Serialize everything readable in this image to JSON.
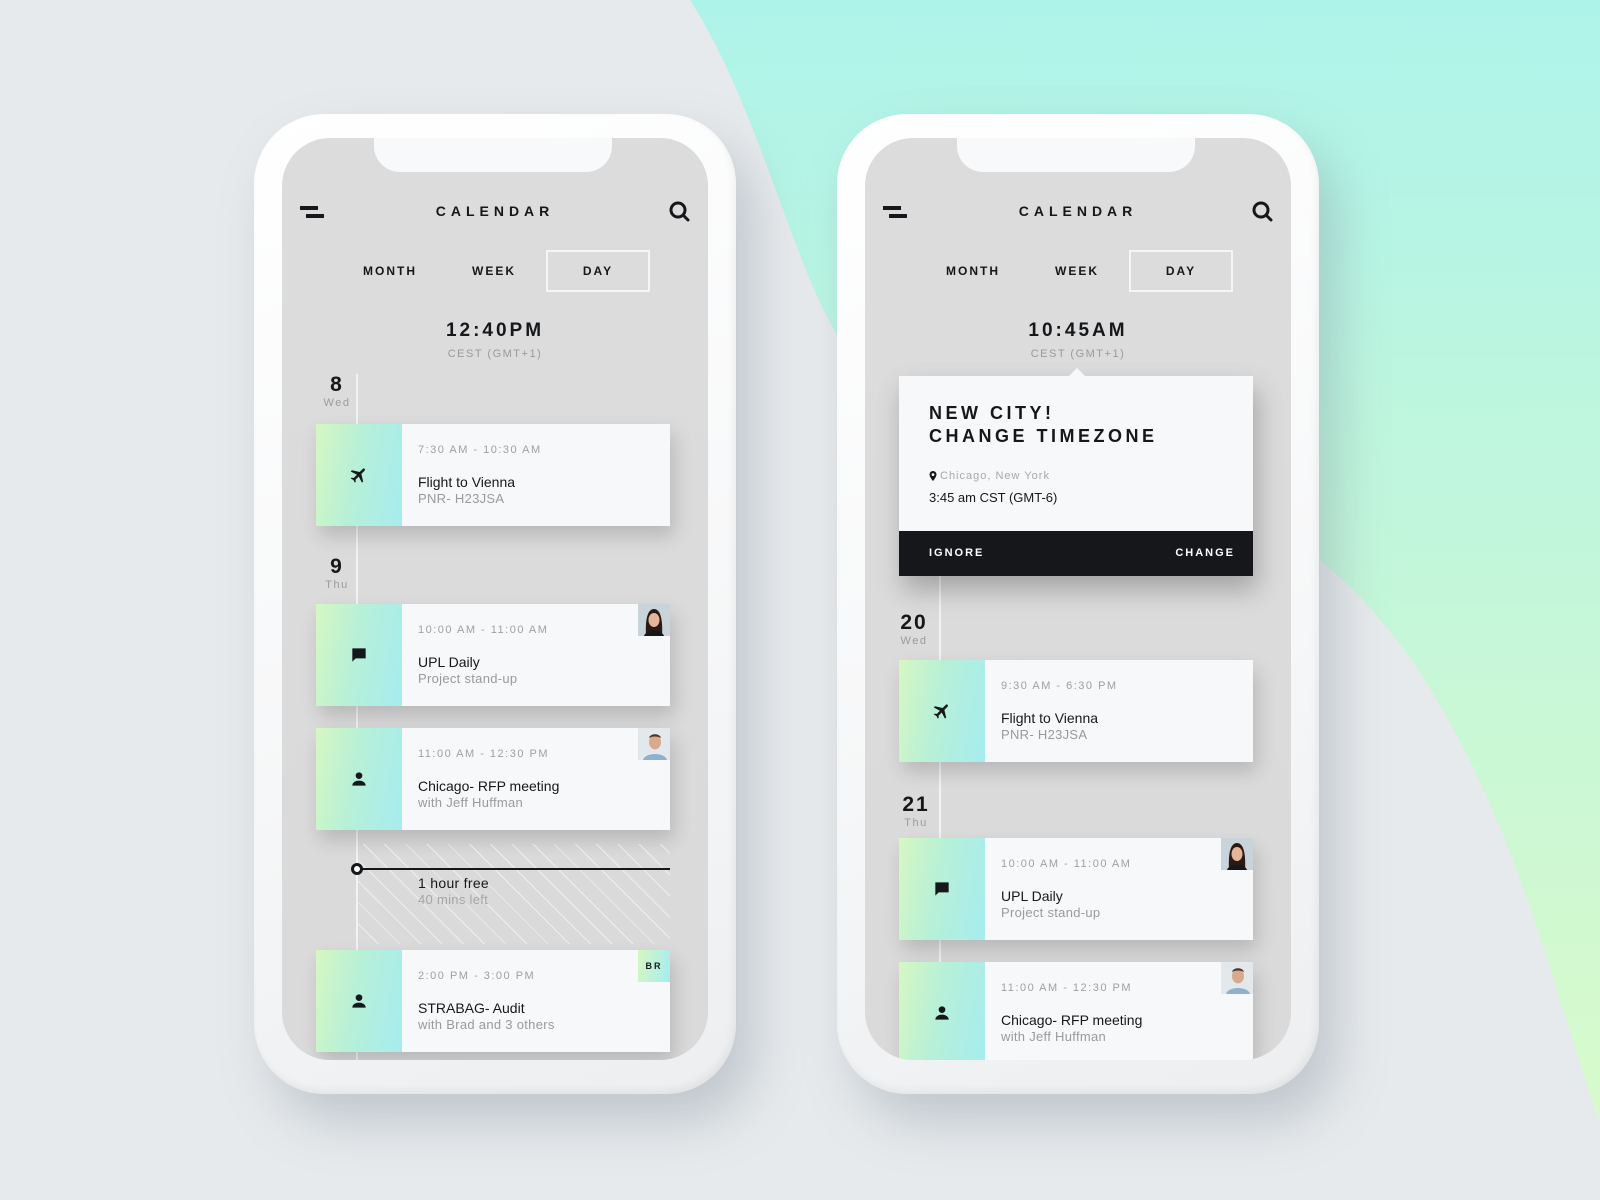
{
  "theme": {
    "accent_gradient_start": "#d6f7c2",
    "accent_gradient_end": "#a6ecf0",
    "background": "#e7eaec",
    "blob_top": "#aef3ea",
    "blob_bottom": "#d6f9cc",
    "text_dark": "#15171a"
  },
  "phones": [
    {
      "header": {
        "title": "CALENDAR",
        "menu_icon": "menu-icon",
        "search_icon": "search-icon"
      },
      "tabs": [
        {
          "label": "MONTH",
          "active": false
        },
        {
          "label": "WEEK",
          "active": false
        },
        {
          "label": "DAY",
          "active": true
        }
      ],
      "current_time": "12:40PM",
      "timezone": "CEST (GMT+1)",
      "days": [
        {
          "num": "8",
          "name": "Wed",
          "events": [
            {
              "time": "7:30 AM - 10:30 AM",
              "title": "Flight to Vienna",
              "subtitle": "PNR- H23JSA",
              "icon": "plane-icon",
              "avatar": null
            }
          ]
        },
        {
          "num": "9",
          "name": "Thu",
          "events": [
            {
              "time": "10:00 AM - 11:00 AM",
              "title": "UPL Daily",
              "subtitle": "Project stand-up",
              "icon": "chat-icon",
              "avatar": "woman-avatar"
            },
            {
              "time": "11:00 AM - 12:30 PM",
              "title": "Chicago- RFP meeting",
              "subtitle": "with Jeff Huffman",
              "icon": "person-icon",
              "avatar": "man-avatar"
            },
            {
              "time": "2:00 PM - 3:00 PM",
              "title": "STRABAG- Audit",
              "subtitle": "with Brad and 3 others",
              "icon": "person-icon",
              "avatar_initials": "BR"
            }
          ]
        }
      ],
      "free_slot": {
        "title": "1 hour free",
        "subtitle": "40 mins left"
      }
    },
    {
      "header": {
        "title": "CALENDAR",
        "menu_icon": "menu-icon",
        "search_icon": "search-icon"
      },
      "tabs": [
        {
          "label": "MONTH",
          "active": false
        },
        {
          "label": "WEEK",
          "active": false
        },
        {
          "label": "DAY",
          "active": true
        }
      ],
      "current_time": "10:45AM",
      "timezone": "CEST (GMT+1)",
      "popup": {
        "title_line1": "NEW CITY!",
        "title_line2": "CHANGE TIMEZONE",
        "location": "Chicago, New York",
        "local_time": "3:45 am CST (GMT-6)",
        "ignore_label": "IGNORE",
        "change_label": "CHANGE"
      },
      "days": [
        {
          "num": "20",
          "name": "Wed",
          "events": [
            {
              "time": "9:30 AM - 6:30 PM",
              "title": "Flight to Vienna",
              "subtitle": "PNR- H23JSA",
              "icon": "plane-icon",
              "avatar": null
            }
          ]
        },
        {
          "num": "21",
          "name": "Thu",
          "events": [
            {
              "time": "10:00 AM - 11:00 AM",
              "title": "UPL Daily",
              "subtitle": "Project stand-up",
              "icon": "chat-icon",
              "avatar": "woman-avatar"
            },
            {
              "time": "11:00 AM - 12:30 PM",
              "title": "Chicago- RFP meeting",
              "subtitle": "with Jeff Huffman",
              "icon": "person-icon",
              "avatar": "man-avatar"
            }
          ]
        }
      ]
    }
  ]
}
